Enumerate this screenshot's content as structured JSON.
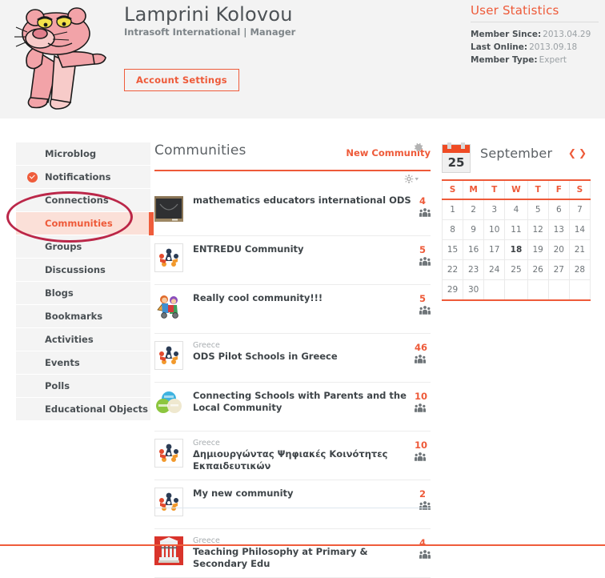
{
  "header": {
    "avatar_alt": "pink-panther-avatar",
    "name": "Lamprini Kolovou",
    "subtitle": "Intrasoft International | Manager",
    "account_settings_label": "Account Settings"
  },
  "user_statistics": {
    "title": "User Statistics",
    "rows": [
      {
        "label": "Member Since:",
        "value": "2013.04.29"
      },
      {
        "label": "Last Online:",
        "value": "2013.09.18"
      },
      {
        "label": "Member Type:",
        "value": "Expert"
      }
    ]
  },
  "sidebar": {
    "items": [
      {
        "label": "Microblog",
        "icon": "",
        "active": false
      },
      {
        "label": "Notifications",
        "icon": "check-circle-icon",
        "active": false
      },
      {
        "label": "Connections",
        "icon": "",
        "active": false
      },
      {
        "label": "Communities",
        "icon": "",
        "active": true
      },
      {
        "label": "Groups",
        "icon": "",
        "active": false
      },
      {
        "label": "Discussions",
        "icon": "",
        "active": false
      },
      {
        "label": "Blogs",
        "icon": "",
        "active": false
      },
      {
        "label": "Bookmarks",
        "icon": "",
        "active": false
      },
      {
        "label": "Activities",
        "icon": "",
        "active": false
      },
      {
        "label": "Events",
        "icon": "",
        "active": false
      },
      {
        "label": "Polls",
        "icon": "",
        "active": false
      },
      {
        "label": "Educational Objects",
        "icon": "",
        "active": false
      }
    ]
  },
  "annotation": {
    "shape": "ellipse",
    "target": "Communities",
    "color": "#b5153a"
  },
  "main": {
    "title": "Communities",
    "new_community_label": "New Community",
    "settings_icon": "gear-icon",
    "list_settings_icon": "gear-dropdown-icon",
    "members_icon": "group-members-icon",
    "items": [
      {
        "thumb": "blackboard-thumbnail",
        "location": "",
        "name": "mathematics educators international ODS",
        "members": "4"
      },
      {
        "thumb": "people-group-thumbnail",
        "location": "",
        "name": "ENTREDU Community",
        "members": "5"
      },
      {
        "thumb": "cartoon-kids-thumbnail",
        "location": "",
        "name": "Really cool community!!!",
        "members": "5"
      },
      {
        "thumb": "people-group-thumbnail",
        "location": "Greece",
        "name": "ODS Pilot Schools in Greece",
        "members": "46"
      },
      {
        "thumb": "venn-circles-thumbnail",
        "location": "",
        "name": "Connecting Schools with Parents and the Local Community",
        "members": "10"
      },
      {
        "thumb": "people-group-thumbnail",
        "location": "Greece",
        "name": "Δημιουργώντας Ψηφιακές Κοινότητες Εκπαιδευτικών",
        "members": "10"
      },
      {
        "thumb": "people-group-thumbnail",
        "location": "",
        "name": "My new community",
        "members": "2"
      },
      {
        "thumb": "greek-temple-thumbnail",
        "location": "Greece",
        "name": "Teaching Philosophy at Primary & Secondary Edu",
        "members": "4"
      }
    ]
  },
  "calendar": {
    "badge_day": "25",
    "month": "September",
    "prev_label": "❮",
    "next_label": "❯",
    "weekdays": [
      "S",
      "M",
      "T",
      "W",
      "T",
      "F",
      "S"
    ],
    "weeks": [
      [
        "1",
        "2",
        "3",
        "4",
        "5",
        "6",
        "7"
      ],
      [
        "8",
        "9",
        "10",
        "11",
        "12",
        "13",
        "14"
      ],
      [
        "15",
        "16",
        "17",
        "18",
        "19",
        "20",
        "21"
      ],
      [
        "22",
        "23",
        "24",
        "25",
        "26",
        "27",
        "28"
      ],
      [
        "29",
        "30",
        "",
        "",
        "",
        "",
        ""
      ]
    ],
    "today": "18"
  },
  "colors": {
    "accent": "#ee5a39",
    "accent_bar": "#ef5c3b",
    "header_bg": "#f3f3f3",
    "sidebar_item_bg": "#f4f4f4",
    "sidebar_active_bg": "#fbe0d8",
    "annotation": "#b5153a",
    "text_dark": "#4a5054",
    "text_muted": "#9aa0a4"
  }
}
